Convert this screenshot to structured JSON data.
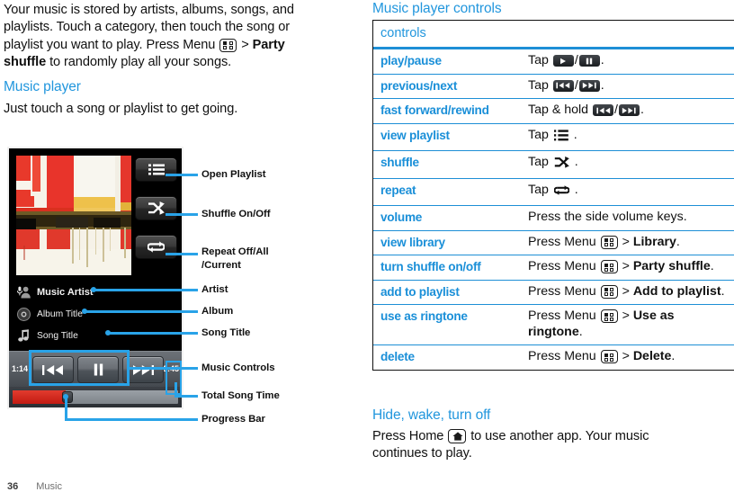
{
  "left": {
    "intro_p1": "Your music is stored by artists, albums, songs, and playlists. Touch a category, then touch the song or playlist you want to play. Press Menu ",
    "intro_p2": " > ",
    "intro_bold1": "Party shuffle",
    "intro_p3": " to randomly play all your songs.",
    "section_heading": "Music player",
    "section_text": "Just touch a song or playlist to get going."
  },
  "phone": {
    "artist": "Music Artist",
    "album": "Album Title",
    "song": "Song Title",
    "elapsed_time": "1:14",
    "total_time": "3:45",
    "progress_percent": 32,
    "icons": {
      "playlist": "playlist-icon",
      "shuffle": "shuffle-icon",
      "repeat": "repeat-icon",
      "artist": "artist-icon",
      "album": "album-disc-icon",
      "song": "music-note-icon",
      "previous": "previous-icon",
      "pause": "pause-icon",
      "next": "next-icon"
    }
  },
  "callouts": [
    {
      "label": "Open Playlist"
    },
    {
      "label": "Shuffle On/Off"
    },
    {
      "label": "Repeat Off/All"
    },
    {
      "label": "/Current"
    },
    {
      "label": "Artist"
    },
    {
      "label": "Album"
    },
    {
      "label": "Song Title"
    },
    {
      "label": "Music Controls"
    },
    {
      "label": "Total Song Time"
    },
    {
      "label": "Progress Bar"
    }
  ],
  "right": {
    "section_heading": "Music player controls",
    "table": {
      "header": "controls",
      "rows": [
        {
          "control": "play/pause",
          "action_pre": "Tap ",
          "icons": [
            "play",
            "pause"
          ],
          "sep": "/",
          "action_post": "."
        },
        {
          "control": "previous/next",
          "action_pre": "Tap ",
          "icons": [
            "previous",
            "next"
          ],
          "sep": "/",
          "action_post": "."
        },
        {
          "control": "fast forward/rewind",
          "action_pre": "Tap & hold ",
          "icons": [
            "previous",
            "next"
          ],
          "sep": "/",
          "action_post": "."
        },
        {
          "control": "view playlist",
          "action_pre": "Tap ",
          "glyph": "playlist",
          "action_post": " ."
        },
        {
          "control": "shuffle",
          "action_pre": "Tap ",
          "glyph": "shuffle",
          "action_post": " ."
        },
        {
          "control": "repeat",
          "action_pre": "Tap ",
          "glyph": "repeat",
          "action_post": " ."
        },
        {
          "control": "volume",
          "action_plain": "Press the side volume keys."
        },
        {
          "control": "view library",
          "action_pre": "Press Menu ",
          "menukey": true,
          "action_mid": " > ",
          "bold": "Library",
          "action_post": "."
        },
        {
          "control": "turn shuffle on/off",
          "action_pre": "Press Menu ",
          "menukey": true,
          "action_mid": " > ",
          "bold": "Party shuffle",
          "action_post": "."
        },
        {
          "control": "add to playlist",
          "action_pre": "Press Menu ",
          "menukey": true,
          "action_mid": " > ",
          "bold": "Add to playlist",
          "action_post": "."
        },
        {
          "control": "use as ringtone",
          "action_pre": "Press Menu ",
          "menukey": true,
          "action_mid": " > ",
          "bold": "Use as ringtone",
          "action_post": "."
        },
        {
          "control": "delete",
          "action_pre": "Press Menu ",
          "menukey": true,
          "action_mid": " > ",
          "bold": "Delete",
          "action_post": "."
        }
      ]
    },
    "hide_heading": "Hide, wake, turn off",
    "hide_text_pre": "Press Home ",
    "hide_text_post": " to use another app. Your music continues to play."
  },
  "footer": {
    "page_number": "36",
    "chapter": "Music"
  },
  "colors": {
    "accent_blue": "#2196dd",
    "link_blue": "#1a8fd8",
    "callout_blue": "#29a3e8",
    "progress_red": "#c21b12"
  }
}
